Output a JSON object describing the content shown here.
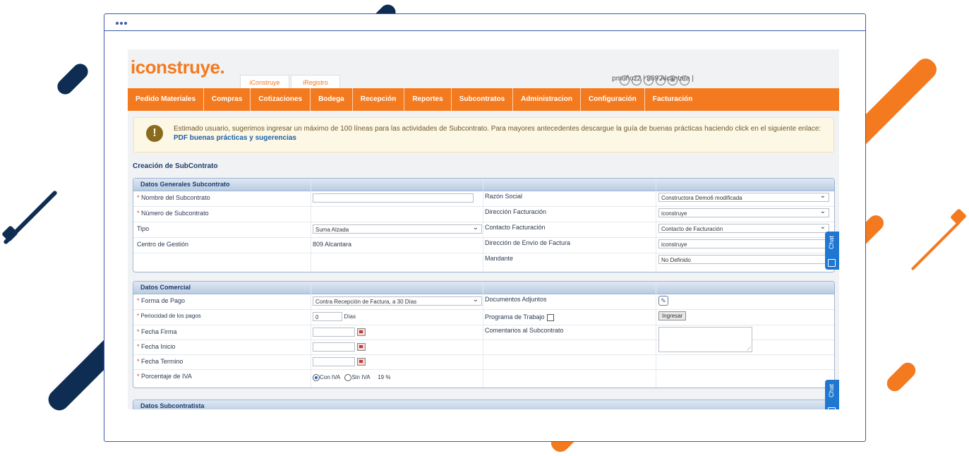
{
  "brand": {
    "logo": "iconstruye.",
    "accent": "#f47a1f",
    "navy": "#0f2d52"
  },
  "top_tabs": [
    "iConstruye",
    "iRegistro"
  ],
  "userbar": {
    "text": "pmuñoz2 | 809 Alcantara |"
  },
  "user_icons": [
    "help-icon",
    "home-icon",
    "settings-icon",
    "user-icon",
    "lock-icon",
    "power-icon"
  ],
  "nav": [
    "Pedido Materiales",
    "Compras",
    "Cotizaciones",
    "Bodega",
    "Recepción",
    "Reportes",
    "Subcontratos",
    "Administracion",
    "Configuración",
    "Facturación"
  ],
  "notice": {
    "text": "Estimado usuario, sugerimos ingresar un máximo de 100 líneas para las actividades de Subcontrato. Para mayores antecedentes descargue la guía de buenas prácticas haciendo click en el siguiente enlace:",
    "link": "PDF buenas prácticas y sugerencias"
  },
  "page_title": "Creación de SubContrato",
  "general": {
    "title": "Datos Generales Subcontrato",
    "nombre_label": "Nombre del Subcontrato",
    "numero_label": "Número de Subcontrato",
    "tipo_label": "Tipo",
    "tipo_value": "Suma Alzada",
    "centro_label": "Centro de Gestión",
    "centro_value": "809 Alcantara",
    "razon_label": "Razón Social",
    "razon_value": "Constructora Demo6 modificada",
    "direccion_label": "Dirección Facturación",
    "direccion_value": "iconstruye",
    "contacto_label": "Contacto Facturación",
    "contacto_value": "Contacto de Facturación",
    "envio_label": "Dirección de Envío de Factura",
    "envio_value": "iconstruye",
    "mandante_label": "Mandante",
    "mandante_value": "No Definido"
  },
  "comercial": {
    "title": "Datos Comercial",
    "forma_label": "Forma de Pago",
    "forma_value": "Contra Recepción de Factura, a 30 Días",
    "periodicidad_label": "Periocidad de los pagos",
    "periodicidad_value": "0",
    "dias_label": "Días",
    "firma_label": "Fecha Firma",
    "inicio_label": "Fecha Inicio",
    "termino_label": "Fecha Termino",
    "iva_label": "Porcentaje de IVA",
    "con_iva": "Con IVA",
    "sin_iva": "Sin IVA",
    "iva_pct": "19 %",
    "docs_label": "Documentos Adjuntos",
    "programa_label": "Programa de Trabajo",
    "ingresar_label": "Ingresar",
    "comentarios_label": "Comentarios al Subcontrato"
  },
  "subcontratista": {
    "title": "Datos Subcontratista"
  },
  "chat_label": "Chat"
}
